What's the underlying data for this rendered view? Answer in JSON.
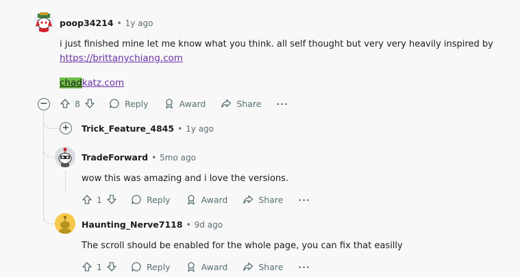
{
  "comments": {
    "top": {
      "username": "poop34214",
      "time": "1y ago",
      "body": "i just finished mine let me know what you think. all self thought but very very heavily inspired by",
      "link1": "https://brittanychiang.com",
      "link2_highlight": "chad",
      "link2_rest": "katz.com",
      "votes": "8",
      "collapse_glyph": "−"
    },
    "collapsed_reply": {
      "username": "Trick_Feature_4845",
      "time": "1y ago",
      "expand_glyph": "+"
    },
    "reply2": {
      "username": "TradeForward",
      "time": "5mo ago",
      "body": "wow this was amazing and i love the versions.",
      "votes": "1"
    },
    "reply3": {
      "username": "Haunting_Nerve7118",
      "time": "9d ago",
      "body": "The scroll should be enabled for the whole page, you can fix that easilly",
      "votes": "1"
    }
  },
  "labels": {
    "reply": "Reply",
    "award": "Award",
    "share": "Share",
    "more": "···",
    "sep": "•"
  },
  "colors": {
    "highlight": "#6fbf4a",
    "link": "#6a2fa6",
    "meta": "#5c6c74",
    "background": "#f8f8f8"
  }
}
